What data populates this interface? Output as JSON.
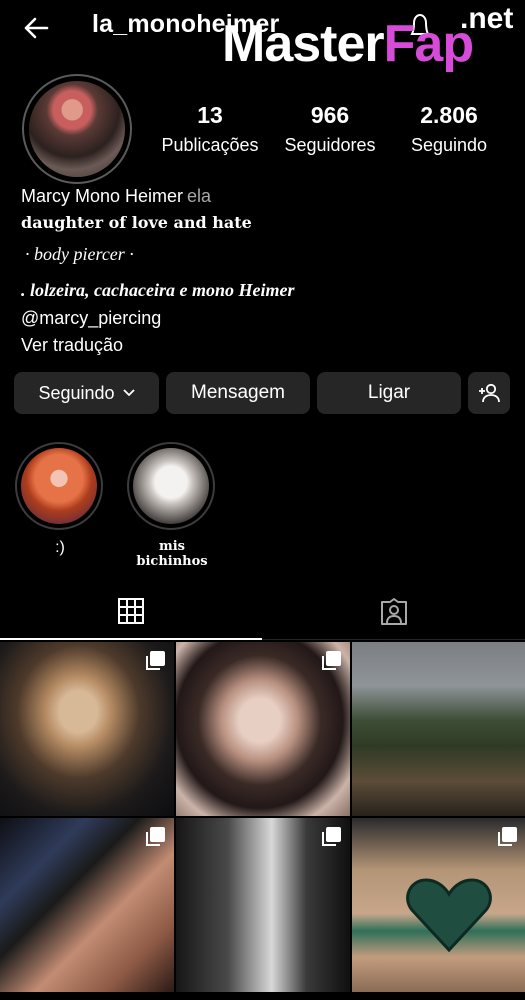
{
  "header": {
    "username": "la_monoheimer",
    "watermark_main": "MasterFap",
    "watermark_part1": "Master",
    "watermark_part2": "Fap",
    "watermark_suffix": ".net"
  },
  "profile": {
    "stats": [
      {
        "value": "13",
        "label": "Publicações"
      },
      {
        "value": "966",
        "label": "Seguidores"
      },
      {
        "value": "2.806",
        "label": "Seguindo"
      }
    ],
    "name": "Marcy Mono Heimer",
    "pronoun": "ela",
    "bio_line1": "daughter of love and hate",
    "bio_line2": "· body piercer ·",
    "bio_line3": ". lolzeira, cachaceira e mono Heimer",
    "mention": "@marcy_piercing",
    "translate": "Ver tradução"
  },
  "actions": {
    "following": "Seguindo",
    "message": "Mensagem",
    "call": "Ligar"
  },
  "highlights": [
    {
      "label": ":)"
    },
    {
      "label": "mis bichinhos"
    }
  ],
  "icons": {
    "back": "arrow-left-icon",
    "notifications": "bell-icon",
    "chevron": "chevron-down-icon",
    "add_user": "add-user-icon",
    "grid": "grid-icon",
    "tagged": "tagged-person-icon",
    "multi": "multiple-photos-icon"
  },
  "colors": {
    "background": "#000000",
    "button": "#262626",
    "secondary_text": "#a8a8a8",
    "watermark_accent": "#d64bd7"
  }
}
